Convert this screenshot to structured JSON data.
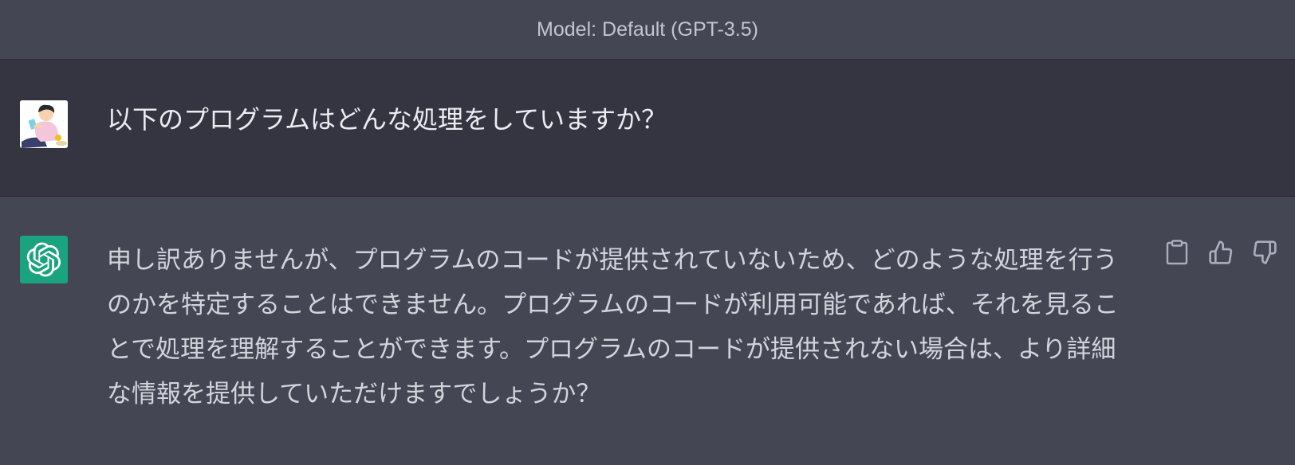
{
  "header": {
    "model_label": "Model: Default (GPT-3.5)"
  },
  "conversation": {
    "user_message": {
      "avatar_icon": "user-avatar-illustration",
      "text": "以下のプログラムはどんな処理をしていますか？"
    },
    "assistant_message": {
      "avatar_icon": "openai-logo-icon",
      "avatar_color": "#19a37f",
      "text": "申し訳ありませんが、プログラムのコードが提供されていないため、どのような処理を行うのかを特定することはできません。プログラムのコードが利用可能であれば、それを見ることで処理を理解することができます。プログラムのコードが提供されない場合は、より詳細な情報を提供していただけますでしょうか？",
      "actions": [
        {
          "name": "copy",
          "icon": "clipboard-icon"
        },
        {
          "name": "thumbs-up",
          "icon": "thumbs-up-icon"
        },
        {
          "name": "thumbs-down",
          "icon": "thumbs-down-icon"
        }
      ]
    }
  },
  "colors": {
    "page_bg": "#444654",
    "user_row_bg": "#343541",
    "text": "#d1d5db",
    "accent": "#19a37f"
  }
}
